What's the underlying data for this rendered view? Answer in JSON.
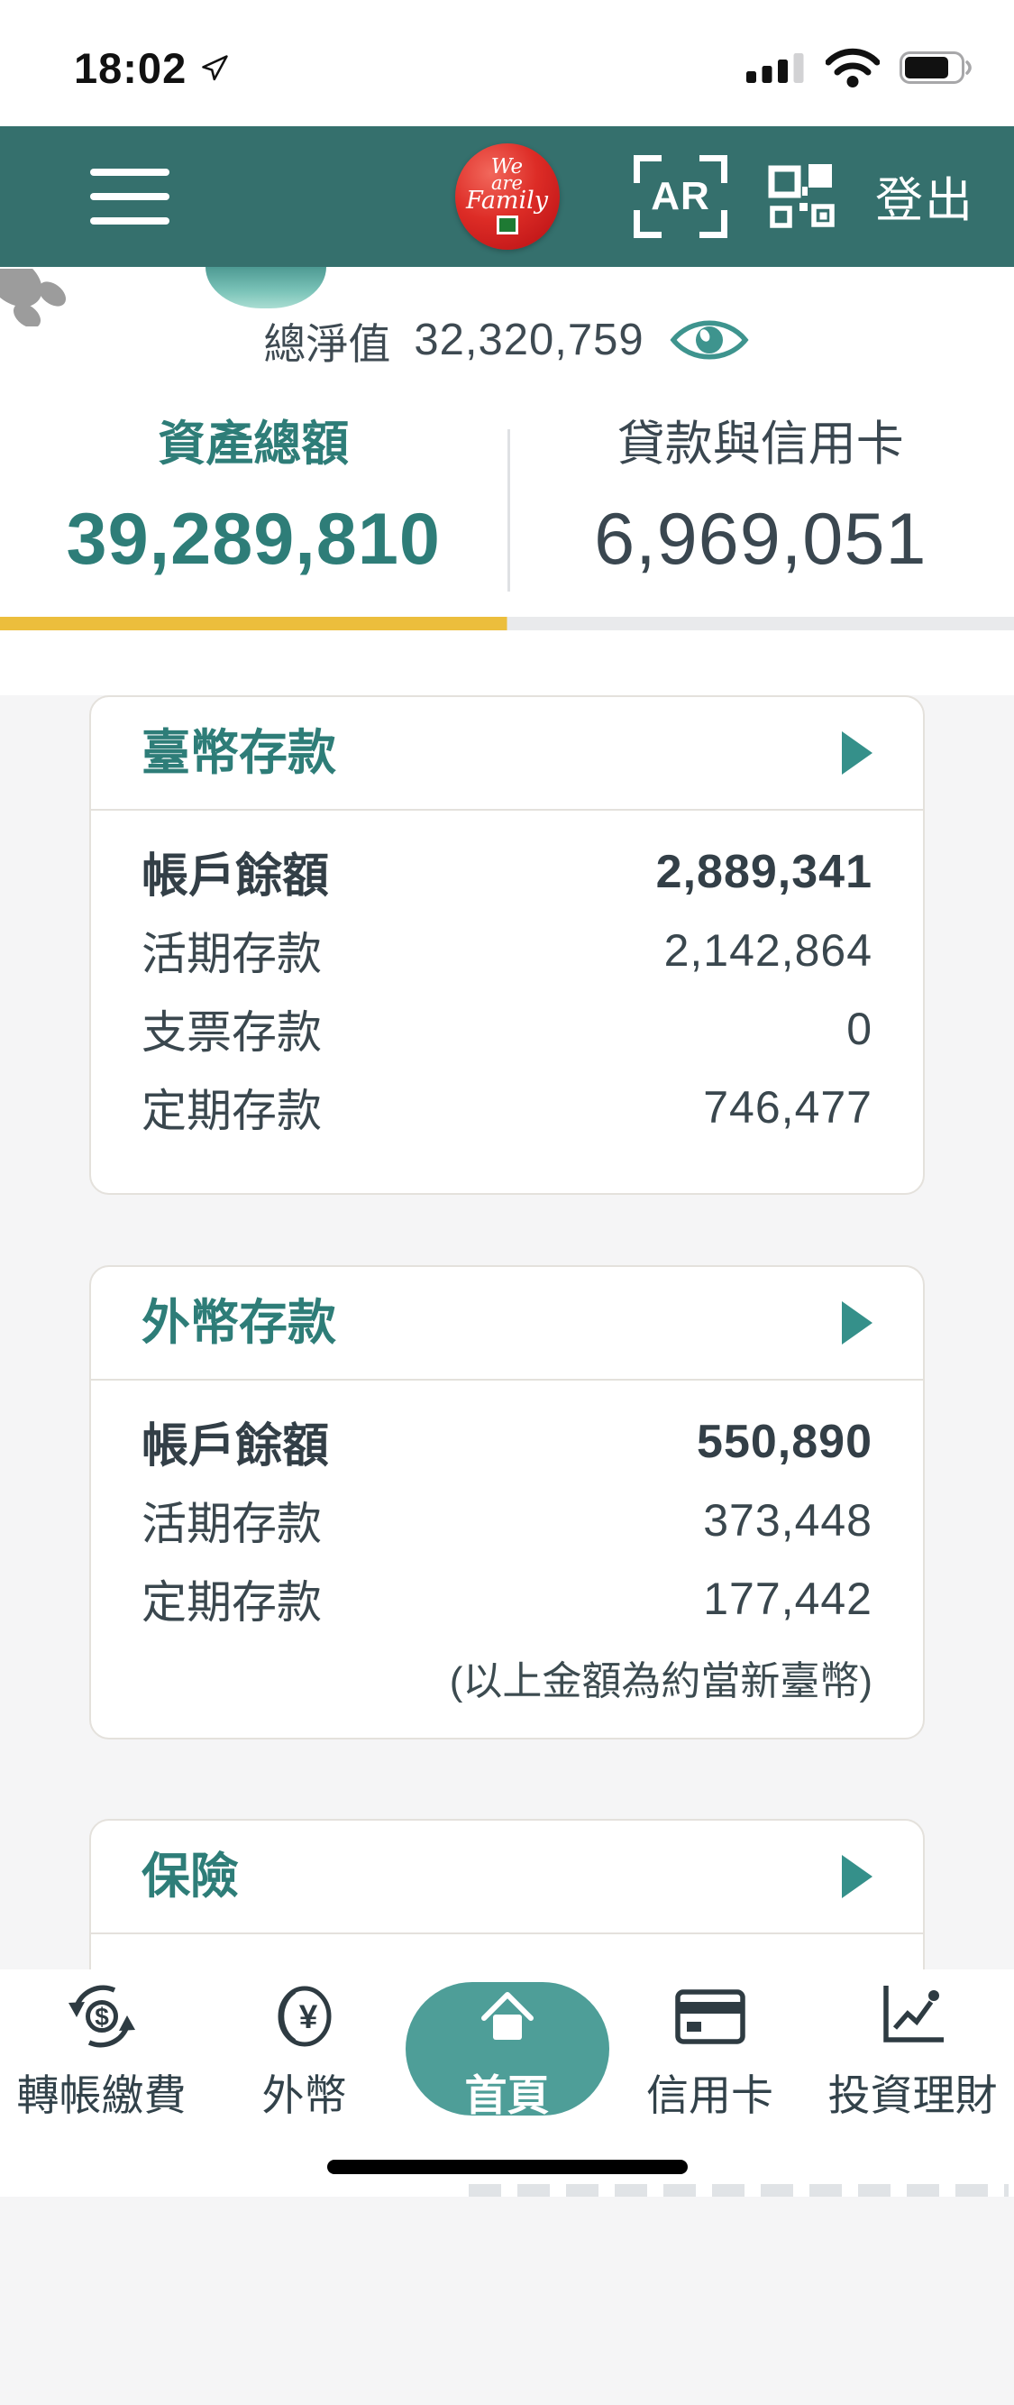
{
  "status_bar": {
    "time": "18:02"
  },
  "header": {
    "logo_lines": [
      "We",
      "are",
      "Family"
    ],
    "ar_label": "AR",
    "logout_label": "登出"
  },
  "net_worth": {
    "label": "總淨值",
    "value": "32,320,759"
  },
  "tabs": [
    {
      "label": "資產總額",
      "value": "39,289,810",
      "active": true
    },
    {
      "label": "貸款與信用卡",
      "value": "6,969,051",
      "active": false
    }
  ],
  "cards": {
    "twd": {
      "title": "臺幣存款",
      "rows": [
        {
          "label": "帳戶餘額",
          "value": "2,889,341",
          "emphasis": true
        },
        {
          "label": "活期存款",
          "value": "2,142,864"
        },
        {
          "label": "支票存款",
          "value": "0"
        },
        {
          "label": "定期存款",
          "value": "746,477"
        }
      ]
    },
    "foreign": {
      "title": "外幣存款",
      "rows": [
        {
          "label": "帳戶餘額",
          "value": "550,890",
          "emphasis": true
        },
        {
          "label": "活期存款",
          "value": "373,448"
        },
        {
          "label": "定期存款",
          "value": "177,442"
        }
      ],
      "note": "(以上金額為約當新臺幣)"
    },
    "insurance": {
      "title": "保險"
    }
  },
  "bottom_nav": {
    "items": [
      {
        "label": "轉帳繳費",
        "icon": "transfer-icon",
        "active": false
      },
      {
        "label": "外幣",
        "icon": "foreign-currency-icon",
        "active": false
      },
      {
        "label": "首頁",
        "icon": "home-icon",
        "active": true
      },
      {
        "label": "信用卡",
        "icon": "credit-card-icon",
        "active": false
      },
      {
        "label": "投資理財",
        "icon": "investment-icon",
        "active": false
      }
    ]
  },
  "colors": {
    "header_teal": "#35706D",
    "accent_teal": "#2E7D78",
    "pill_teal": "#4E9E98",
    "highlight_yellow": "#ECBE3C"
  }
}
